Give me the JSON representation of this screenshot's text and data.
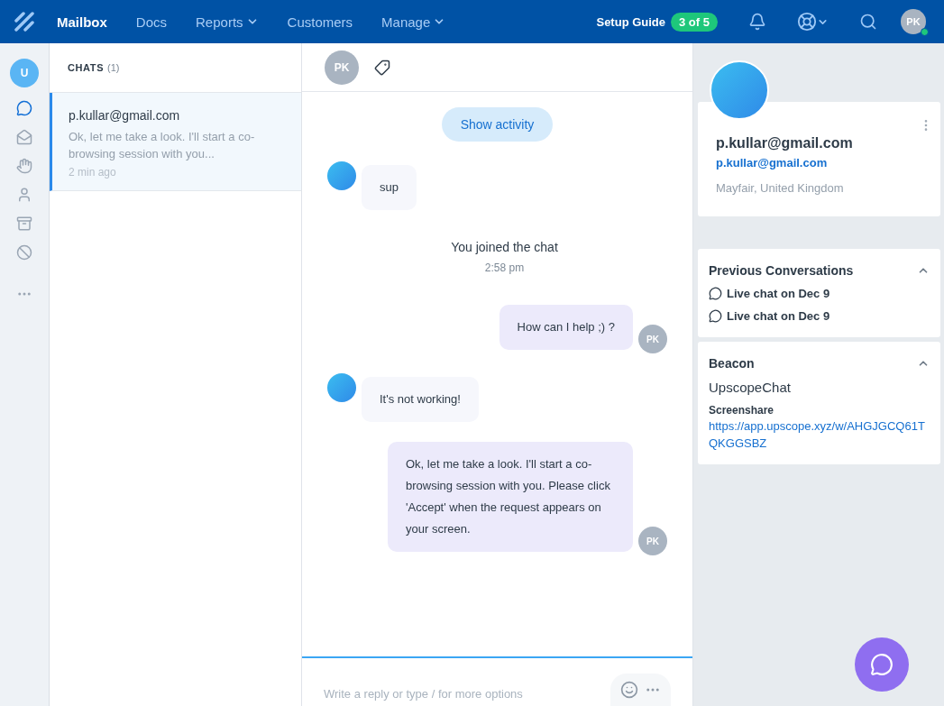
{
  "topbar": {
    "nav": [
      {
        "label": "Mailbox",
        "selected": true,
        "dropdown": false
      },
      {
        "label": "Docs",
        "selected": false,
        "dropdown": false
      },
      {
        "label": "Reports",
        "selected": false,
        "dropdown": true
      },
      {
        "label": "Customers",
        "selected": false,
        "dropdown": false
      },
      {
        "label": "Manage",
        "selected": false,
        "dropdown": true
      }
    ],
    "setup_guide": {
      "label": "Setup Guide",
      "badge": "3 of 5"
    },
    "user": {
      "initials": "PK",
      "online": true
    }
  },
  "rail": {
    "avatar": "U",
    "items": [
      {
        "kind": "chats",
        "selected": true
      },
      {
        "kind": "inbox",
        "selected": false
      },
      {
        "kind": "hand",
        "selected": false
      },
      {
        "kind": "person",
        "selected": false
      },
      {
        "kind": "archive",
        "selected": false
      },
      {
        "kind": "blocked",
        "selected": false
      },
      {
        "kind": "more",
        "selected": false
      }
    ]
  },
  "chats": {
    "title": "CHATS",
    "count": "(1)",
    "items": [
      {
        "from": "p.kullar@gmail.com",
        "preview": "Ok, let me take a look. I'll start a co-browsing session with you...",
        "time": "2 min ago",
        "selected": true
      }
    ]
  },
  "conversation": {
    "header_initials": "PK",
    "show_activity": "Show activity",
    "messages": [
      {
        "kind": "customer",
        "text": "sup"
      },
      {
        "kind": "system",
        "text": "You joined the chat",
        "time": "2:58 pm"
      },
      {
        "kind": "agent",
        "text": "How can I help ;) ?",
        "initials": "PK"
      },
      {
        "kind": "customer",
        "text": "It's not working!"
      },
      {
        "kind": "agent",
        "text": "Ok, let me take a look. I'll start a co-browsing session with you. Please click 'Accept' when the request appears on your screen.",
        "initials": "PK"
      }
    ],
    "composer": {
      "placeholder": "Write a reply or type / for more options"
    }
  },
  "profile": {
    "name": "p.kullar@gmail.com",
    "email": "p.kullar@gmail.com",
    "location": "Mayfair, United Kingdom"
  },
  "previous_conversations": {
    "title": "Previous Conversations",
    "expanded": true,
    "items": [
      "Live chat on Dec 9",
      "Live chat on Dec 9"
    ]
  },
  "beacon": {
    "title": "Beacon",
    "expanded": true,
    "name": "UpscopeChat",
    "label": "Screenshare",
    "link": "https://app.upscope.xyz/w/AHGJGCQ61TQKGGSBZ"
  }
}
